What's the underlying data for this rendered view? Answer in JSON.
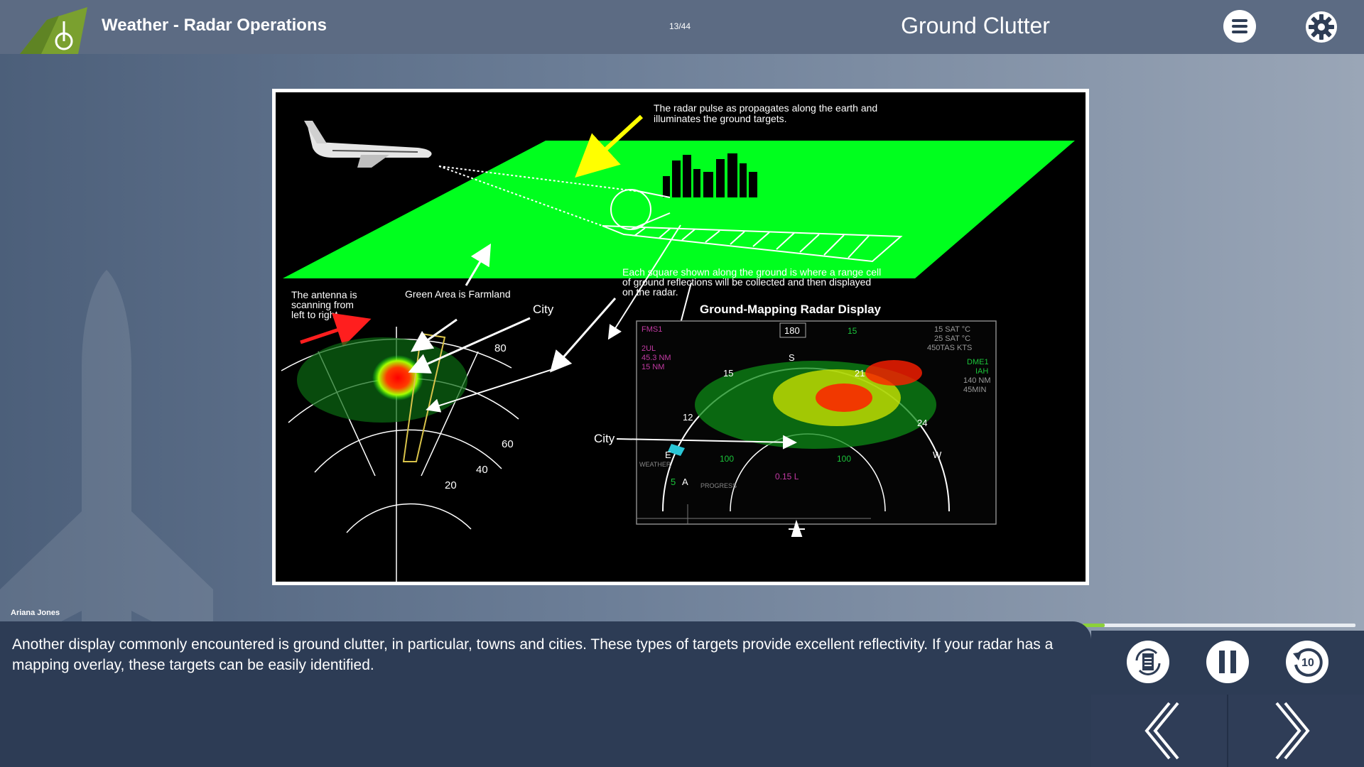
{
  "header": {
    "course_title": "Weather - Radar Operations",
    "page_counter": "13/44",
    "slide_title": "Ground Clutter"
  },
  "figure": {
    "pulse_caption_1": "The radar pulse as propagates along the earth and",
    "pulse_caption_2": "illuminates the ground targets.",
    "range_cell_caption_1": "Each square shown along the ground is where a range cell",
    "range_cell_caption_2": "of ground reflections will be collected and then displayed",
    "range_cell_caption_3": "on the radar.",
    "antenna_caption_1": "The antenna is",
    "antenna_caption_2": "scanning from",
    "antenna_caption_3": "left to right.",
    "farmland_label": "Green Area is Farmland",
    "city_label": "City",
    "display_title": "Ground-Mapping Radar Display",
    "display_city_label": "City",
    "range_labels": [
      "80",
      "60",
      "40",
      "20"
    ],
    "display": {
      "top_left": [
        "FMS1",
        "2UL",
        "45.3 NM",
        "15 NM"
      ],
      "heading_box": "180",
      "range_top": "15",
      "top_right": [
        "15 SAT °C",
        "25 SAT °C",
        "450TAS KTS"
      ],
      "right_info": [
        "DME1",
        "IAH",
        "140 NM",
        "45MIN"
      ],
      "compass": [
        "S",
        "15",
        "21",
        "12",
        "24",
        "E",
        "W"
      ],
      "arc_labels": [
        "100",
        "100"
      ],
      "weather_label": "WEATHER",
      "mode_values": [
        "5",
        "A"
      ],
      "progress_label": "PROGRESS",
      "tilt": "0.15 L"
    }
  },
  "narrator": "Ariana Jones",
  "transcript": "Another display commonly encountered is ground clutter, in particular, towns and cities. These types of targets provide excellent reflectivity. If your radar has a mapping overlay, these targets can be easily identified.",
  "progress": 0.08,
  "colors": {
    "farmland": "#00ff1e",
    "progress": "#8cd13a",
    "panel": "#2d3c55",
    "logo": "#7aa02f"
  },
  "icons": {
    "menu": "hamburger-menu-icon",
    "settings": "gear-icon",
    "transcript_toggle": "transcript-refresh-icon",
    "pause": "pause-icon",
    "replay": "replay-10-icon",
    "prev": "chevron-left-icon",
    "next": "chevron-right-icon"
  }
}
